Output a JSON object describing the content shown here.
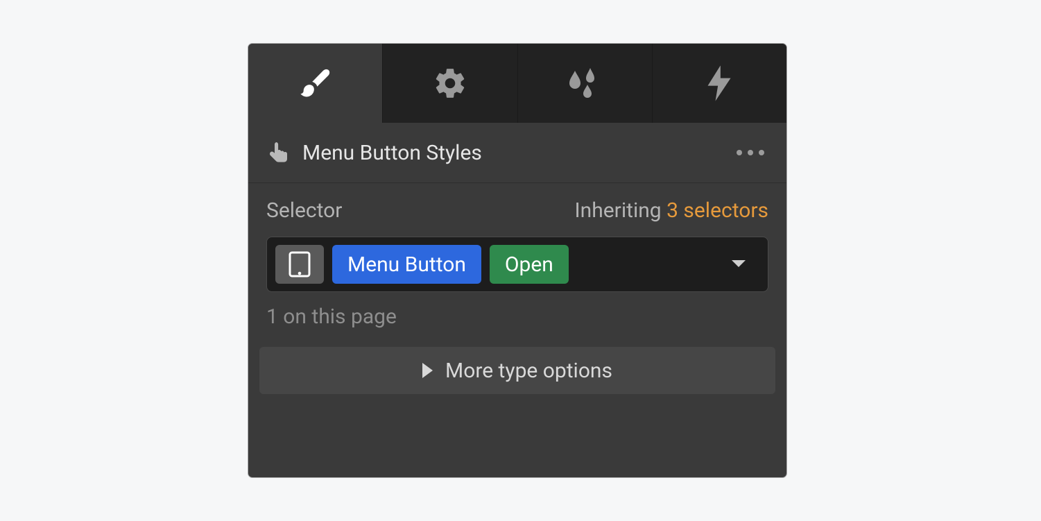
{
  "header": {
    "title": "Menu Button Styles"
  },
  "selector": {
    "label": "Selector",
    "inheriting_prefix": "Inheriting ",
    "inheriting_count_text": "3 selectors",
    "class_chip": "Menu Button",
    "state_chip": "Open",
    "instance_count": "1 on this page"
  },
  "more_options": {
    "label": "More type options"
  },
  "tabs": {
    "items": [
      "style",
      "settings",
      "effects",
      "interactions"
    ],
    "active": "style"
  },
  "colors": {
    "panel_bg": "#3a3a3a",
    "tab_bg": "#222222",
    "class_chip": "#2d68de",
    "state_chip": "#2f8a4d",
    "accent_orange": "#e69a3c"
  }
}
